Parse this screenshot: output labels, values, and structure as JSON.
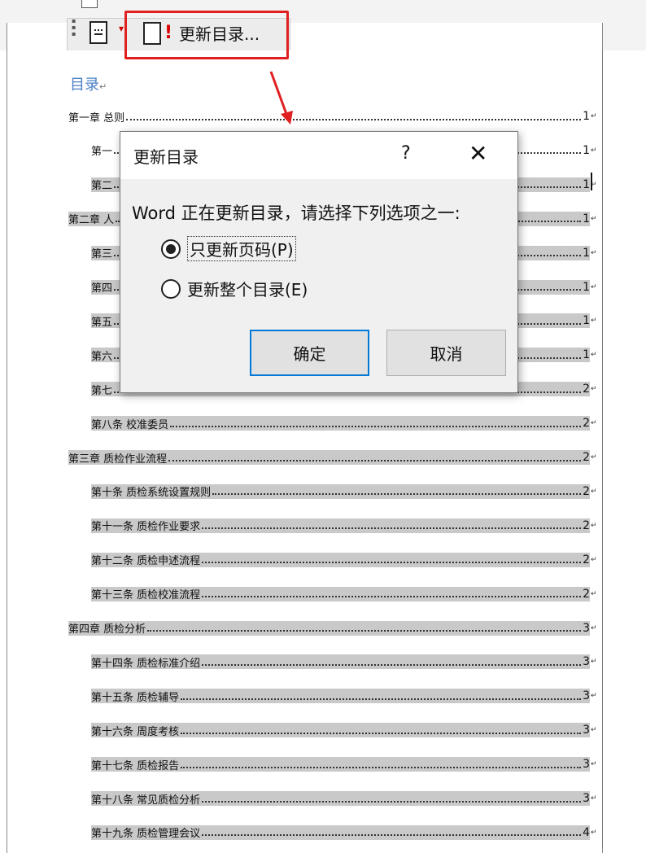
{
  "toolbar": {
    "update_toc_label": "更新目录..."
  },
  "toc": {
    "title": "目录",
    "entries": [
      {
        "level": 1,
        "text": "第一章  总则",
        "page": "1",
        "highlight": false
      },
      {
        "level": 2,
        "text": "第一",
        "page": "1",
        "highlight": false
      },
      {
        "level": 2,
        "text": "第二",
        "page": "1",
        "highlight": true
      },
      {
        "level": 1,
        "text": "第二章  人",
        "page": "1",
        "highlight": true
      },
      {
        "level": 2,
        "text": "第三",
        "page": "1",
        "highlight": true
      },
      {
        "level": 2,
        "text": "第四",
        "page": "1",
        "highlight": true
      },
      {
        "level": 2,
        "text": "第五",
        "page": "1",
        "highlight": true
      },
      {
        "level": 2,
        "text": "第六",
        "page": "1",
        "highlight": true
      },
      {
        "level": 2,
        "text": "第七",
        "page": "2",
        "highlight": true
      },
      {
        "level": 2,
        "text": "第八条  校准委员",
        "page": "2",
        "highlight": true
      },
      {
        "level": 1,
        "text": "第三章  质检作业流程",
        "page": "2",
        "highlight": true
      },
      {
        "level": 2,
        "text": "第十条  质检系统设置规则",
        "page": "2",
        "highlight": true
      },
      {
        "level": 2,
        "text": "第十一条  质检作业要求",
        "page": "2",
        "highlight": true
      },
      {
        "level": 2,
        "text": "第十二条  质检申述流程",
        "page": "2",
        "highlight": true
      },
      {
        "level": 2,
        "text": "第十三条  质检校准流程",
        "page": "2",
        "highlight": true
      },
      {
        "level": 1,
        "text": "第四章  质检分析",
        "page": "3",
        "highlight": true
      },
      {
        "level": 2,
        "text": "第十四条  质检标准介绍",
        "page": "3",
        "highlight": true
      },
      {
        "level": 2,
        "text": "第十五条  质检辅导",
        "page": "3",
        "highlight": true
      },
      {
        "level": 2,
        "text": "第十六条  周度考核",
        "page": "3",
        "highlight": true
      },
      {
        "level": 2,
        "text": "第十七条  质检报告",
        "page": "3",
        "highlight": true
      },
      {
        "level": 2,
        "text": "第十八条  常见质检分析",
        "page": "3",
        "highlight": true
      },
      {
        "level": 2,
        "text": "第十九条  质检管理会议",
        "page": "4",
        "highlight": true
      }
    ]
  },
  "dialog": {
    "title": "更新目录",
    "help": "?",
    "close": "✕",
    "message": "Word 正在更新目录，请选择下列选项之一:",
    "option_pages": "只更新页码(P)",
    "option_all": "更新整个目录(E)",
    "selected": "option_pages",
    "ok": "确定",
    "cancel": "取消"
  },
  "colors": {
    "accent": "#0078d7",
    "annotation": "#e02020",
    "toc_title": "#4a7fc6"
  }
}
